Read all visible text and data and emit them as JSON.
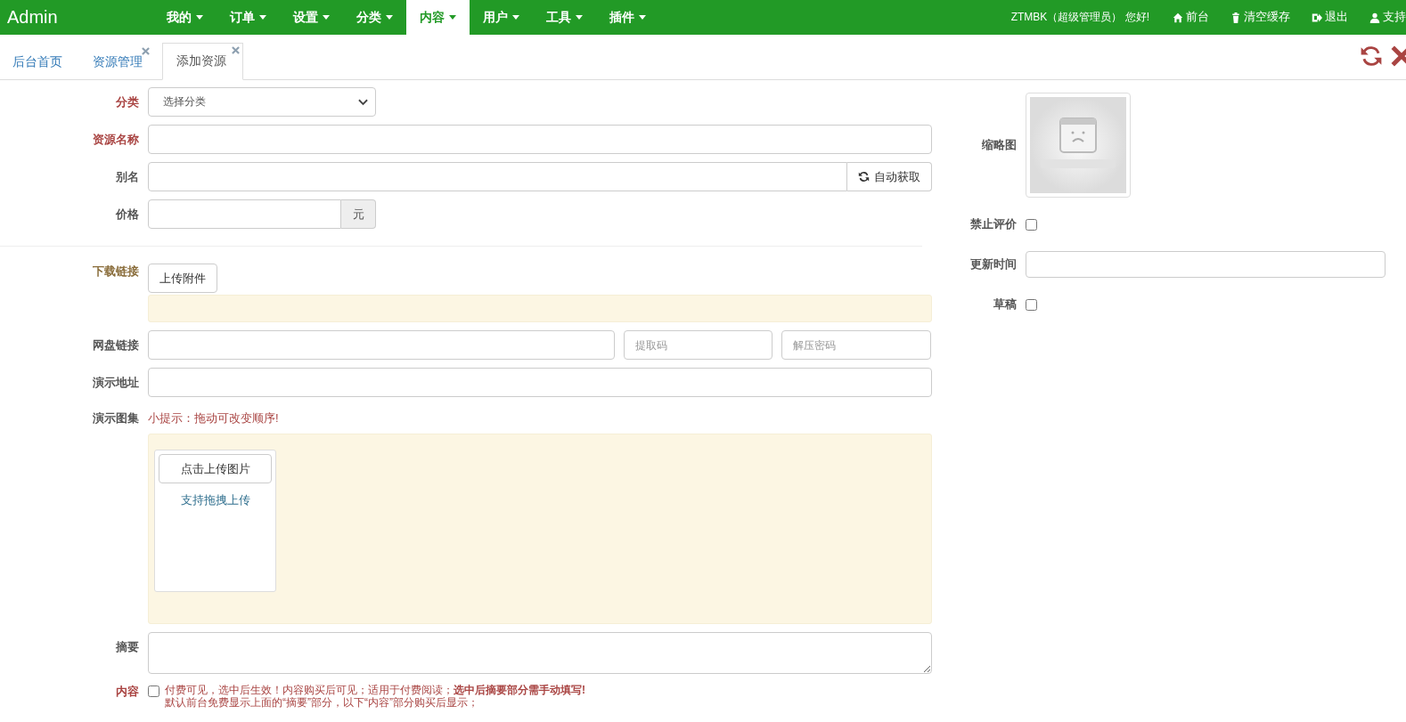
{
  "navbar": {
    "brand": "Admin",
    "menu": [
      {
        "label": "我的",
        "selected": false
      },
      {
        "label": "订单",
        "selected": false
      },
      {
        "label": "设置",
        "selected": false
      },
      {
        "label": "分类",
        "selected": false
      },
      {
        "label": "内容",
        "selected": true
      },
      {
        "label": "用户",
        "selected": false
      },
      {
        "label": "工具",
        "selected": false
      },
      {
        "label": "插件",
        "selected": false
      }
    ],
    "greeting": "ZTMBK（超级管理员） 您好!",
    "links": [
      {
        "kind": "home",
        "label": "前台"
      },
      {
        "kind": "trash",
        "label": "清空缓存"
      },
      {
        "kind": "logout",
        "label": "退出"
      },
      {
        "kind": "user",
        "label": "支持"
      }
    ]
  },
  "tabs": [
    {
      "label": "后台首页",
      "selected": false,
      "closable": false
    },
    {
      "label": "资源管理",
      "selected": false,
      "closable": true
    },
    {
      "label": "添加资源",
      "selected": true,
      "closable": true
    }
  ],
  "form": [
    {
      "kind": "select",
      "label": "分类",
      "color": "#a94442",
      "value": "选择分类"
    },
    {
      "kind": "text",
      "label": "资源名称",
      "color": "#a94442"
    },
    {
      "kind": "text-button",
      "label": "别名",
      "color": "#555555",
      "button": "自动获取"
    },
    {
      "kind": "text-addon",
      "label": "价格",
      "color": "#555555",
      "addon": "元"
    },
    {
      "kind": "divider"
    },
    {
      "kind": "upload",
      "label": "下载链接",
      "color": "#8a6d3b",
      "button": "上传附件"
    },
    {
      "kind": "netdisk",
      "label": "网盘链接",
      "color": "#555555",
      "placeholders": [
        "提取码",
        "解压密码"
      ]
    },
    {
      "kind": "text",
      "label": "演示地址",
      "color": "#555555"
    },
    {
      "kind": "gallery",
      "label": "演示图集",
      "color": "#555555",
      "hint": "小提示：拖动可改变顺序!",
      "button": "点击上传图片",
      "note": "支持拖拽上传"
    },
    {
      "kind": "textarea",
      "label": "摘要",
      "color": "#555555"
    },
    {
      "kind": "paid",
      "label": "内容",
      "color": "#a94442",
      "checked": false,
      "notes": [
        "付费可见，选中后生效！内容购买后可见；适用于付费阅读；**选中后摘要部分需手动填写!**",
        "默认前台免费显示上面的“摘要”部分，以下“内容”部分购买后显示；"
      ]
    }
  ],
  "side": [
    {
      "kind": "thumbnail",
      "label": "缩略图"
    },
    {
      "kind": "checkbox",
      "label": "禁止评价",
      "checked": false
    },
    {
      "kind": "text",
      "label": "更新时间"
    },
    {
      "kind": "checkbox",
      "label": "草稿",
      "checked": false
    }
  ]
}
